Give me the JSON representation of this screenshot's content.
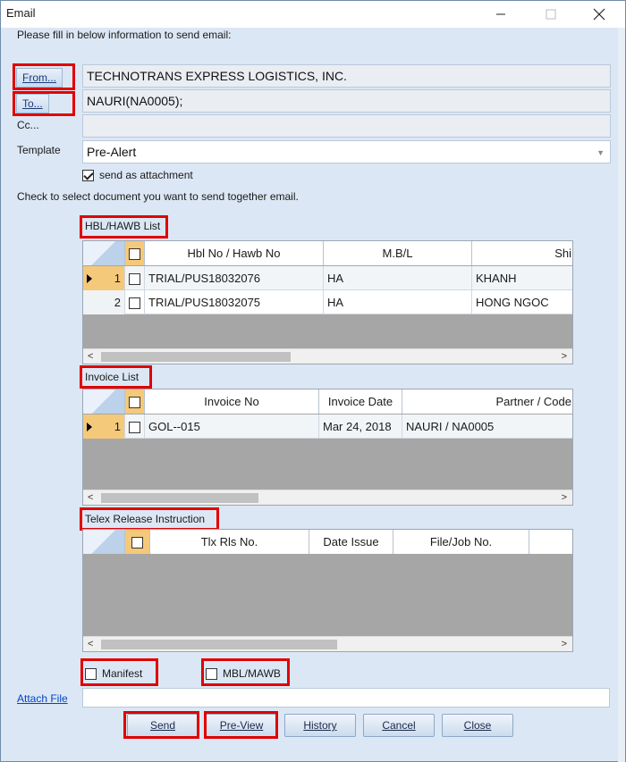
{
  "window": {
    "title": "Email"
  },
  "instructions": "Please fill in below information to send email:",
  "from": {
    "label": "From...",
    "value": "TECHNOTRANS EXPRESS LOGISTICS, INC."
  },
  "to": {
    "label": "To...",
    "value": "NAURI(NA0005);"
  },
  "cc": {
    "label": "Cc...",
    "value": ""
  },
  "template": {
    "label": "Template",
    "value": "Pre-Alert"
  },
  "send_as_attachment": {
    "label": "send as attachment",
    "checked": true
  },
  "check_instructions": "Check to select document you want to send together email.",
  "hbl_list": {
    "title": "HBL/HAWB List",
    "columns": [
      "Hbl No / Hawb No",
      "M.B/L",
      "Shi"
    ],
    "rows": [
      {
        "num": "1",
        "hbl": "TRIAL/PUS18032076",
        "mbl": "HA",
        "shipper": "KHANH"
      },
      {
        "num": "2",
        "hbl": "TRIAL/PUS18032075",
        "mbl": "HA",
        "shipper": "HONG NGOC"
      }
    ]
  },
  "invoice_list": {
    "title": "Invoice List",
    "columns": [
      "Invoice No",
      "Invoice Date",
      "Partner / Code"
    ],
    "rows": [
      {
        "num": "1",
        "invoice_no": "GOL--015",
        "date": "Mar 24, 2018",
        "partner": "NAURI / NA0005"
      }
    ]
  },
  "telex_list": {
    "title": "Telex Release Instruction",
    "columns": [
      "Tlx Rls No.",
      "Date Issue",
      "File/Job No."
    ]
  },
  "manifest": {
    "label": "Manifest"
  },
  "mbl_mawb": {
    "label": "MBL/MAWB"
  },
  "attach_file": {
    "label": "Attach File"
  },
  "buttons": {
    "send": "Send",
    "preview": "Pre-View",
    "history": "History",
    "cancel": "Cancel",
    "close": "Close"
  },
  "colors": {
    "highlight": "#e00000",
    "accent": "#f5c97a",
    "background": "#dbe7f4"
  }
}
